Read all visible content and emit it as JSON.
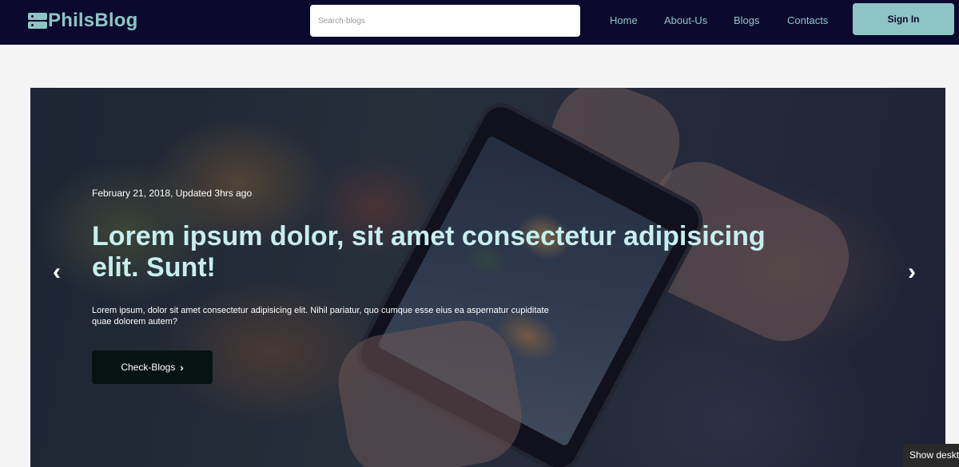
{
  "header": {
    "logo_text": "PhilsBlog",
    "logo_icon": "server-icon",
    "search": {
      "placeholder": "Search-blogs",
      "value": ""
    },
    "nav": [
      {
        "label": "Home"
      },
      {
        "label": "About-Us"
      },
      {
        "label": "Blogs"
      },
      {
        "label": "Contacts"
      }
    ],
    "signin_label": "Sign In"
  },
  "hero": {
    "date": "February 21, 2018, Updated 3hrs ago",
    "title": "Lorem ipsum dolor, sit amet consectetur adipisicing elit. Sunt!",
    "text": "Lorem ipsum, dolor sit amet consectetur adipisicing elit. Nihil pariatur, quo cumque esse eius ea aspernatur cupiditate quae dolorem autem?",
    "button_label": "Check-Blogs",
    "button_icon": "chevron-right-icon",
    "prev_icon": "chevron-left-icon",
    "next_icon": "chevron-right-icon"
  },
  "desktop_toggle_label": "Show desktop",
  "colors": {
    "navbar_bg": "#0b0a2e",
    "accent": "#8fc4c4",
    "hero_title": "#c7eeee",
    "hero_button_bg": "#051412",
    "page_bg": "#f4f4f4"
  }
}
